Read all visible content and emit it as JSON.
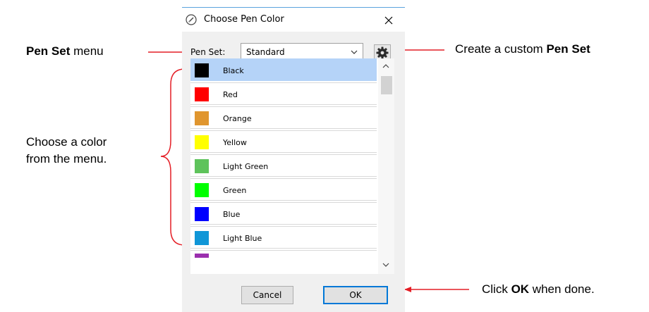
{
  "dialog": {
    "title": "Choose Pen Color",
    "close_symbol": "✕",
    "penset_label": "Pen Set:",
    "penset_value": "Standard",
    "cancel_label": "Cancel",
    "ok_label": "OK"
  },
  "colors": [
    {
      "label": "Black",
      "color": "#000000",
      "selected": true
    },
    {
      "label": "Red",
      "color": "#ff0000"
    },
    {
      "label": "Orange",
      "color": "#e0962f"
    },
    {
      "label": "Yellow",
      "color": "#ffff00"
    },
    {
      "label": "Light Green",
      "color": "#5ec35b"
    },
    {
      "label": "Green",
      "color": "#00ff00"
    },
    {
      "label": "Blue",
      "color": "#0000ff"
    },
    {
      "label": "Light Blue",
      "color": "#1096d7"
    },
    {
      "label": "",
      "color": "#9b2fae"
    }
  ],
  "annotations": {
    "penset_menu": {
      "bold": "Pen Set",
      "text": " menu"
    },
    "create_custom": {
      "text": "Create a custom ",
      "bold": "Pen Set"
    },
    "choose_color_line1": "Choose a color",
    "choose_color_line2": "from the menu.",
    "click_ok": {
      "pre": "Click ",
      "bold": "OK",
      "post": " when done."
    }
  },
  "accent_color": "#0078d7",
  "arrow_color": "#e41e26"
}
